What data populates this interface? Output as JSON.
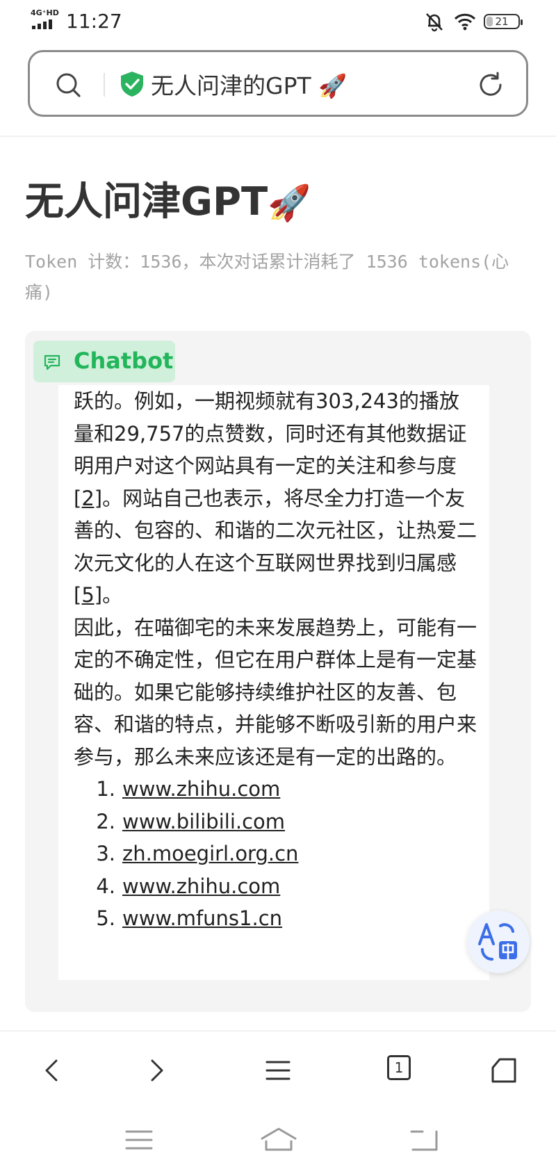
{
  "status_bar": {
    "network": "4G⁺HD",
    "time": "11:27",
    "battery": "21",
    "battery_level_percent": 21
  },
  "url_bar": {
    "title": "无人问津的GPT 🚀",
    "icons": [
      "search-icon",
      "shield-check-icon",
      "reload-icon"
    ],
    "accent_color": "#2bb35f"
  },
  "page": {
    "title": "无人问津GPT",
    "title_emoji": "🚀",
    "token_info": "Token 计数：1536，本次对话累计消耗了 1536 tokens(心痛)"
  },
  "chat": {
    "label": "Chatbot",
    "label_color": "#22b55a",
    "message": {
      "p1_a": "跃的。例如，一期视频就有303,243的播放量和29,757的点赞数，同时还有其他数据证明用户对这个网站具有一定的关注和参与度",
      "p1_ref1": "[2]",
      "p1_b": "。网站自己也表示，将尽全力打造一个友善的、包容的、和谐的二次元社区，让热爱二次元文化的人在这个互联网世界找到归属感",
      "p1_ref2": "[5]",
      "p1_c": "。",
      "p2": "因此，在喵御宅的未来发展趋势上，可能有一定的不确定性，但它在用户群体上是有一定基础的。如果它能够持续维护社区的友善、包容、和谐的特点，并能够不断吸引新的用户来参与，那么未来应该还是有一定的出路的。",
      "refs": [
        {
          "num": "1.",
          "link": "www.zhihu.com"
        },
        {
          "num": "2.",
          "link": "www.bilibili.com"
        },
        {
          "num": "3.",
          "link": "zh.moegirl.org.cn"
        },
        {
          "num": "4.",
          "link": "www.zhihu.com"
        },
        {
          "num": "5.",
          "link": "www.mfuns1.cn"
        }
      ]
    }
  },
  "fab": {
    "icon": "translate-icon"
  },
  "browser_nav": {
    "tab_count": "1",
    "icons": [
      "back-icon",
      "forward-icon",
      "menu-icon",
      "tabs-icon",
      "home-icon"
    ]
  },
  "system_nav": {
    "icons": [
      "recent-apps-icon",
      "system-home-icon",
      "system-back-icon"
    ]
  }
}
